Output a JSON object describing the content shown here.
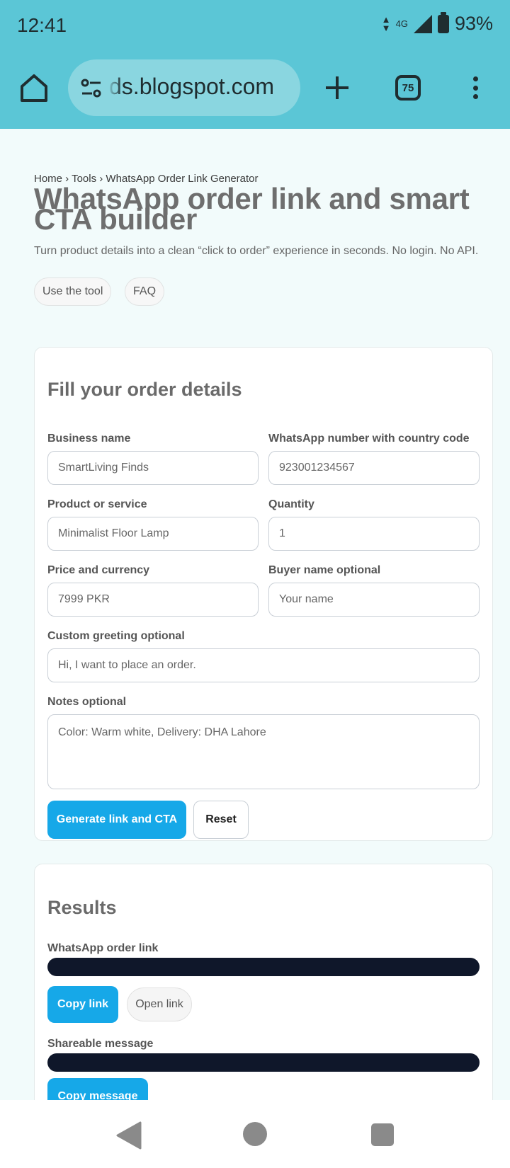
{
  "status_bar": {
    "time": "12:41",
    "network": "4G",
    "battery": "93%"
  },
  "browser": {
    "url": "ds.blogspot.com",
    "tab_count": "75"
  },
  "page": {
    "breadcrumb": "Home › Tools › WhatsApp Order Link Generator",
    "title": "WhatsApp order link and smart CTA builder",
    "subtitle": "Turn product details into a clean “click to order” experience in seconds. No login. No API.",
    "pills": {
      "use_tool": "Use the tool",
      "faq": "FAQ"
    }
  },
  "form": {
    "heading": "Fill your order details",
    "business_name": {
      "label": "Business name",
      "placeholder": "SmartLiving Finds"
    },
    "whatsapp_number": {
      "label": "WhatsApp number with country code",
      "placeholder": "923001234567"
    },
    "product": {
      "label": "Product or service",
      "placeholder": "Minimalist Floor Lamp"
    },
    "quantity": {
      "label": "Quantity",
      "value": "1"
    },
    "price": {
      "label": "Price and currency",
      "placeholder": "7999 PKR"
    },
    "buyer_name": {
      "label": "Buyer name optional",
      "placeholder": "Your name"
    },
    "greeting": {
      "label": "Custom greeting optional",
      "placeholder": "Hi, I want to place an order."
    },
    "notes": {
      "label": "Notes optional",
      "placeholder": "Color: Warm white, Delivery: DHA Lahore"
    },
    "generate_label": "Generate link and CTA",
    "reset_label": "Reset"
  },
  "results": {
    "heading": "Results",
    "link_label": "WhatsApp order link",
    "copy_link_label": "Copy link",
    "open_link_label": "Open link",
    "message_label": "Shareable message",
    "copy_message_label": "Copy message"
  }
}
